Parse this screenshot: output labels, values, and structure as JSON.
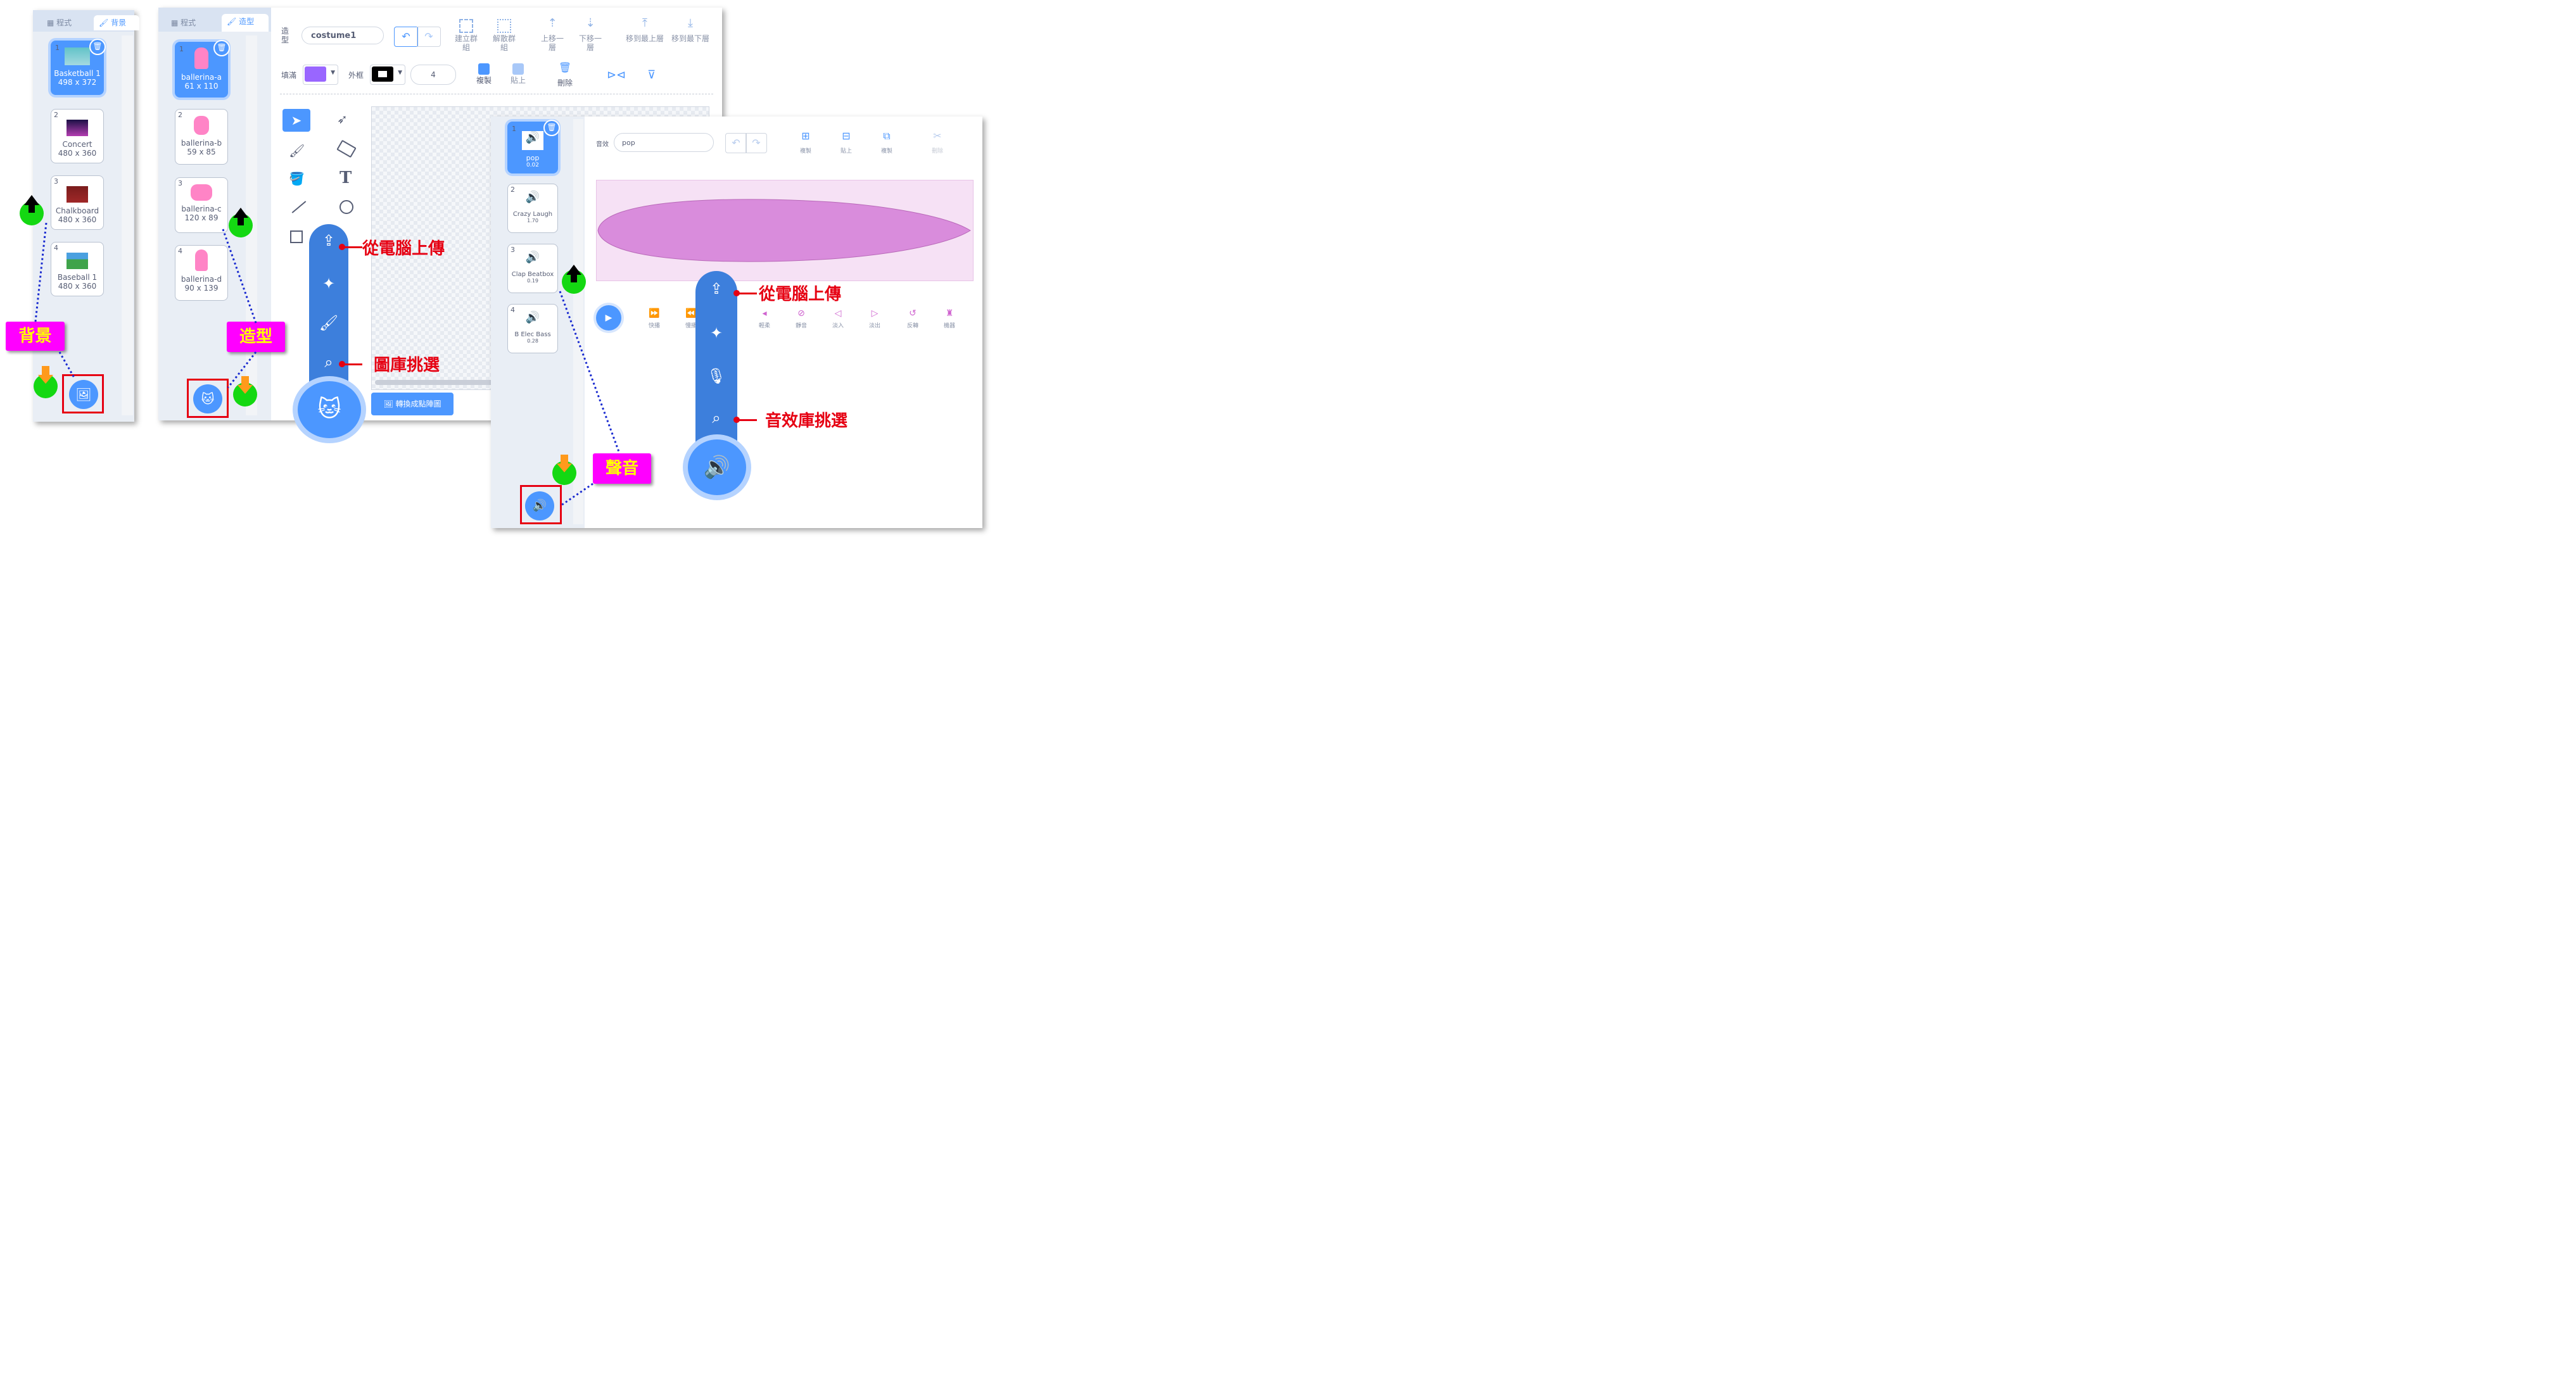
{
  "backdrop_panel": {
    "tabs": [
      "程式",
      "背景"
    ],
    "items": [
      {
        "num": "1",
        "name": "Basketball 1",
        "size": "498 x 372"
      },
      {
        "num": "2",
        "name": "Concert",
        "size": "480 x 360"
      },
      {
        "num": "3",
        "name": "Chalkboard",
        "size": "480 x 360"
      },
      {
        "num": "4",
        "name": "Baseball 1",
        "size": "480 x 360"
      }
    ],
    "tag": "背景"
  },
  "costume_panel": {
    "tabs": [
      "程式",
      "造型"
    ],
    "items": [
      {
        "num": "1",
        "name": "ballerina-a",
        "size": "61 x 110"
      },
      {
        "num": "2",
        "name": "ballerina-b",
        "size": "59 x 85"
      },
      {
        "num": "3",
        "name": "ballerina-c",
        "size": "120 x 89"
      },
      {
        "num": "4",
        "name": "ballerina-d",
        "size": "90 x 139"
      }
    ],
    "tag": "造型",
    "editor": {
      "name_label": "造型",
      "name_value": "costume1",
      "toolbar": [
        "建立群組",
        "解散群組",
        "上移一層",
        "下移一層",
        "移到最上層",
        "移到最下層"
      ],
      "fill_label": "填滿",
      "outline_label": "外框",
      "outline_width": "4",
      "actions": [
        "複製",
        "貼上",
        "刪除"
      ],
      "convert_button": "轉換成點陣圖"
    },
    "callouts": {
      "upload": "從電腦上傳",
      "library": "圖庫挑選"
    }
  },
  "sound_panel": {
    "items": [
      {
        "num": "1",
        "name": "pop",
        "duration": "0.02"
      },
      {
        "num": "2",
        "name": "Crazy Laugh",
        "duration": "1.70"
      },
      {
        "num": "3",
        "name": "Clap Beatbox",
        "duration": "0.19"
      },
      {
        "num": "4",
        "name": "B Elec Bass",
        "duration": "0.28"
      }
    ],
    "tag": "聲音",
    "editor": {
      "name_label": "音效",
      "name_value": "pop",
      "toolbar": [
        "複製",
        "貼上",
        "複製",
        "刪除"
      ],
      "effects": [
        "快播",
        "慢播",
        "輕柔",
        "靜音",
        "淡入",
        "淡出",
        "反轉",
        "機器"
      ]
    },
    "callouts": {
      "upload": "從電腦上傳",
      "library": "音效庫挑選"
    }
  },
  "colors": {
    "accent": "#4c97ff",
    "tag_bg": "#ff00ff",
    "tag_text": "#ffff00",
    "callout": "#e60012",
    "wave": "#d98cdc"
  }
}
